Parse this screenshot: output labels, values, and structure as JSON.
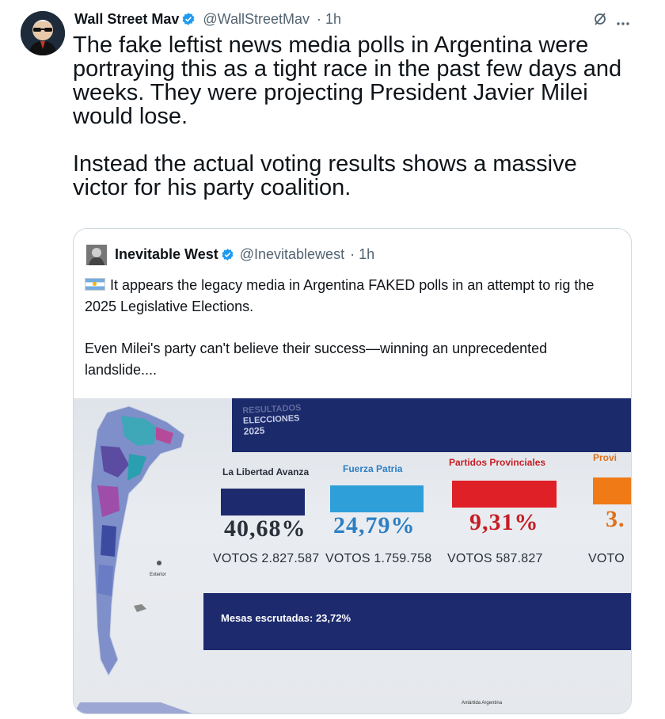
{
  "tweet": {
    "author_name": "Wall Street Mav",
    "handle": "@WallStreetMav",
    "time": "· 1h",
    "paragraphs": [
      "The fake leftist news media polls in Argentina were portraying this as a tight race in the past few days and weeks. They were projecting President Javier Milei would lose.",
      "Instead the actual voting results shows a massive victor for his party coalition."
    ]
  },
  "quoted": {
    "author_name": "Inevitable West",
    "handle": "@Inevitablewest",
    "time": "· 1h",
    "paragraphs": [
      "It appears the legacy media in Argentina FAKED polls in an attempt to rig the 2025 Legislative Elections.",
      "Even Milei's party can't believe their success—winning an unprecedented landslide...."
    ]
  },
  "photo": {
    "banner_line1": "RESULTADOS",
    "banner_line2": "ELECCIONES",
    "banner_year": "2025",
    "parties": [
      {
        "name": "La Libertad Avanza",
        "pct": "40,68%",
        "votos": "VOTOS 2.827.587",
        "color": "#1d2a6e",
        "text_color": "#2b2f3a"
      },
      {
        "name": "Fuerza Patria",
        "pct": "24,79%",
        "votos": "VOTOS 1.759.758",
        "color": "#2e9fd9",
        "text_color": "#2d7fc4"
      },
      {
        "name": "Partidos Provinciales",
        "pct": "9,31%",
        "votos": "VOTOS 587.827",
        "color": "#e02027",
        "text_color": "#c61d24"
      },
      {
        "name": "Provi",
        "pct": "3.",
        "votos": "VOTO",
        "color": "#f07a16",
        "text_color": "#e0701a"
      }
    ],
    "mesas": "Mesas escrutadas: 23,72%",
    "map_label_1": "Exterior",
    "map_label_2": "Antártida Argentina"
  },
  "colors": {
    "verified": "#1d9bf0",
    "muted": "#536471",
    "border": "#cfd9de"
  },
  "icons": [
    "grok-icon",
    "more-icon",
    "verified-icon",
    "argentina-flag-icon"
  ]
}
